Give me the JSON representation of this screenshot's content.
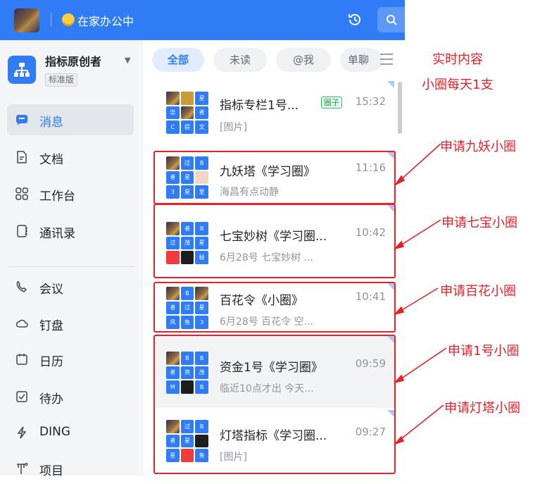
{
  "topbar": {
    "status_text": "在家办公中",
    "history_icon": "history-icon",
    "search_icon": "search-icon"
  },
  "sidebar": {
    "org_name": "指标原创者",
    "org_badge": "标准版",
    "items": [
      {
        "label": "消息",
        "icon": "message-icon",
        "active": true
      },
      {
        "label": "文档",
        "icon": "document-icon"
      },
      {
        "label": "工作台",
        "icon": "apps-icon"
      },
      {
        "label": "通讯录",
        "icon": "contacts-icon"
      },
      {
        "label": "会议",
        "icon": "meeting-icon"
      },
      {
        "label": "钉盘",
        "icon": "cloud-icon"
      },
      {
        "label": "日历",
        "icon": "calendar-icon"
      },
      {
        "label": "待办",
        "icon": "todo-icon"
      },
      {
        "label": "DING",
        "icon": "ding-icon"
      },
      {
        "label": "项目",
        "icon": "project-icon"
      }
    ]
  },
  "tabs": [
    {
      "label": "全部",
      "active": true
    },
    {
      "label": "未读"
    },
    {
      "label": "@我"
    },
    {
      "label": "单聊"
    }
  ],
  "conversations": [
    {
      "name": "指标专栏1号...",
      "tag": "圈子",
      "time": "15:32",
      "preview": "[图片]"
    },
    {
      "name": "九妖塔《学习圈》",
      "time": "11:16",
      "preview": "海昌有点动静"
    },
    {
      "name": "七宝妙树《学习圈...",
      "time": "10:42",
      "preview": "6月28号 七宝妙树 ..."
    },
    {
      "name": "百花令《小圈》",
      "time": "10:41",
      "preview": "6月28号 百花令 空..."
    },
    {
      "name": "资金1号《学习圈》",
      "time": "09:59",
      "preview": "临近10点才出 今天..."
    },
    {
      "name": "灯塔指标《学习圈...",
      "time": "09:27",
      "preview": "[图片]"
    }
  ],
  "avatar_chars": {
    "row0": [
      "",
      "",
      "星",
      "忠",
      "",
      "者",
      "C",
      "提",
      "文"
    ],
    "row1": [
      "",
      "过",
      "B",
      "者",
      "星",
      "",
      "3",
      "星",
      "里"
    ],
    "row2": [
      "",
      "者",
      "B",
      "过",
      "茂",
      "星",
      "",
      "",
      "秘"
    ],
    "row3": [
      "",
      "B",
      "",
      "者",
      "过",
      "星",
      "风",
      "鱼",
      "3"
    ],
    "row4": [
      "",
      "B",
      "B",
      "者",
      "资",
      "茂",
      "M",
      "",
      "B"
    ],
    "row5": [
      "",
      "过",
      "B",
      "者",
      "星",
      "",
      "星",
      "",
      "鱼"
    ]
  },
  "annotations": {
    "top_note_line1": "实时内容",
    "top_note_line2": "小圈每天1支",
    "notes": [
      "申请九妖小圈",
      "申请七宝小圈",
      "申请百花小圈",
      "申请1号小圈",
      "申请灯塔小圈"
    ]
  },
  "colors": {
    "accent": "#2f7cf6",
    "annotation_red": "#e8202a",
    "sidebar_bg": "#f4f5f7"
  }
}
